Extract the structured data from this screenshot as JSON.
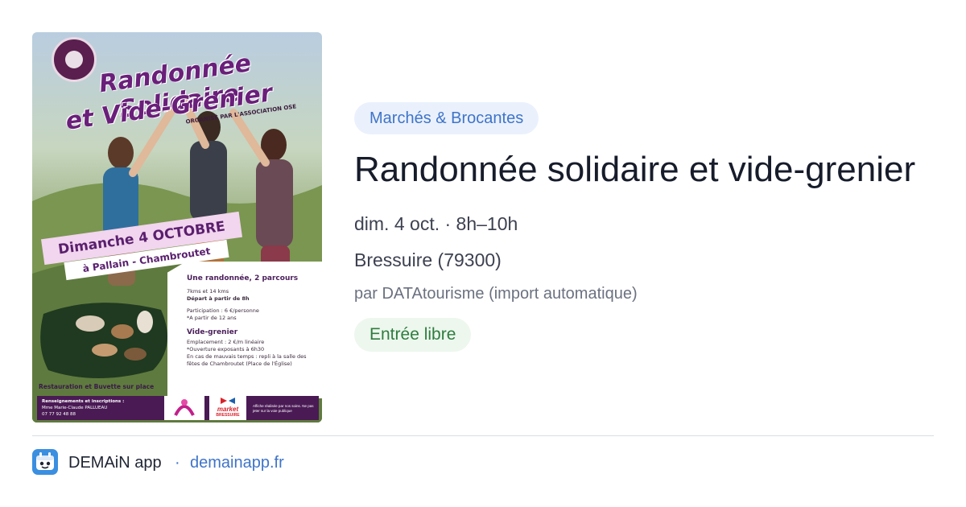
{
  "poster": {
    "title_line1": "Randonnée Solidaire",
    "title_line2": "et Vide-Grenier",
    "organizer": "ORGANISÉ PAR L'ASSOCIATION OSE",
    "date": "Dimanche 4 OCTOBRE",
    "place": "à Pallain - Chambroutet",
    "hike_heading": "Une randonnée, 2 parcours",
    "hike_distances": "7kms et 14 kms",
    "hike_start": "Départ à partir de 8h",
    "hike_fee": "Participation : 6 €/personne",
    "hike_age": "*A partir de 12 ans",
    "sale_heading": "Vide-grenier",
    "sale_space": "Emplacement : 2 €/m linéaire",
    "sale_opening": "*Ouverture exposants à 6h30",
    "sale_weather": "En cas de mauvais temps : repli à la salle des fêtes de Chambroutet (Place de l'Église)",
    "food": "Restauration et Buvette sur place",
    "contact_heading": "Renseignements et inscriptions :",
    "contact_name": "Mme Marie-Claude PALLUEAU",
    "contact_phone": "07 77 92 48 88",
    "sponsor_label": "market",
    "sponsor_city": "BRESSUIRE",
    "legal": "Affiche réalisée par nos soins. Ne pas jeter sur la voie publique"
  },
  "event": {
    "category": "Marchés & Brocantes",
    "title": "Randonnée solidaire et vide-grenier",
    "datetime": "dim. 4 oct. · 8h–10h",
    "location": "Bressuire (79300)",
    "source": "par DATAtourisme (import automatique)",
    "price": "Entrée libre"
  },
  "footer": {
    "app_name": "DEMAiN app",
    "separator": "·",
    "link": "demainapp.fr"
  },
  "colors": {
    "accent_blue": "#3f74c9",
    "category_bg": "#eaf1fc",
    "price_green": "#2e7d3e",
    "price_bg": "#edf7ee",
    "poster_purple": "#6a1f7a"
  },
  "icons": {
    "app_icon": "demain-app-icon",
    "poster_logo": "association-logo"
  }
}
